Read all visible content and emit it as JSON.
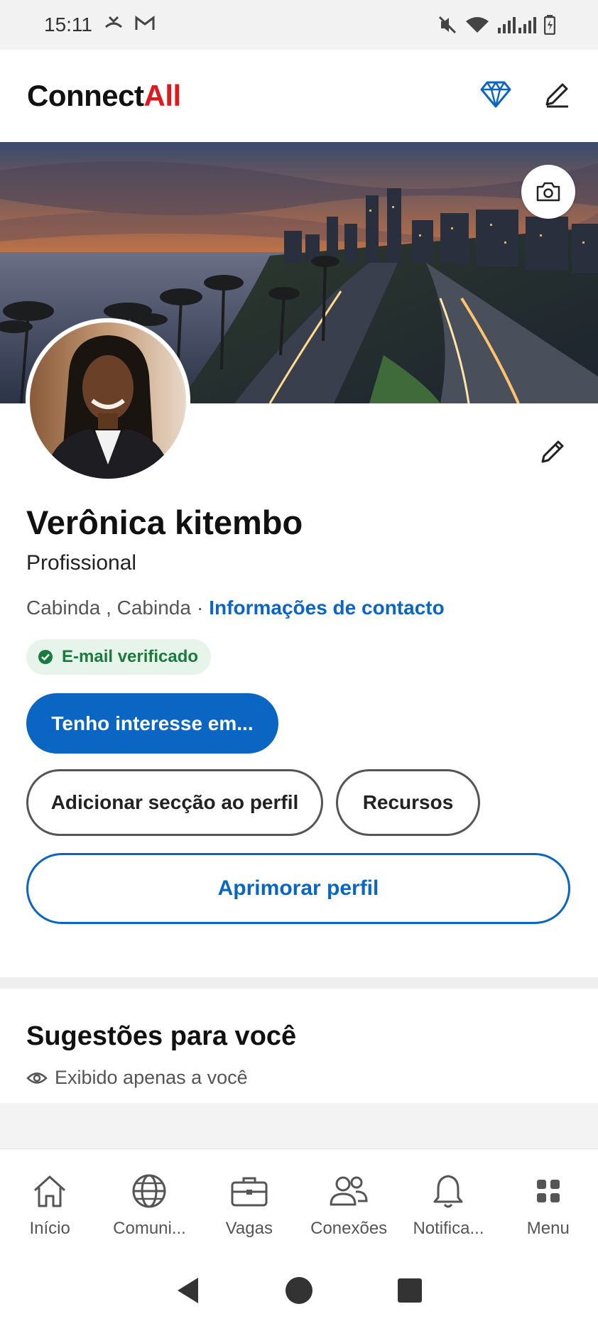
{
  "status_bar": {
    "time": "15:11"
  },
  "app": {
    "logo_part1": "Connect",
    "logo_part2": "All",
    "brand_red": "#e0191f",
    "accent_blue": "#0a66c2"
  },
  "profile": {
    "name": "Verônica kitembo",
    "headline": "Profissional",
    "location": "Cabinda , Cabinda",
    "separator": "·",
    "contact_link": "Informações de contacto",
    "verified_badge": "E-mail verificado"
  },
  "actions": {
    "interest_button": "Tenho interesse em...",
    "add_section_button": "Adicionar secção ao perfil",
    "resources_button": "Recursos",
    "improve_button": "Aprimorar perfil"
  },
  "suggestions": {
    "title": "Sugestões para você",
    "subtitle": "Exibido apenas a você"
  },
  "bottom_nav": [
    {
      "label": "Início",
      "icon": "home-icon"
    },
    {
      "label": "Comuni...",
      "icon": "globe-icon"
    },
    {
      "label": "Vagas",
      "icon": "briefcase-icon"
    },
    {
      "label": "Conexões",
      "icon": "people-icon"
    },
    {
      "label": "Notifica...",
      "icon": "bell-icon"
    },
    {
      "label": "Menu",
      "icon": "grid-icon"
    }
  ]
}
